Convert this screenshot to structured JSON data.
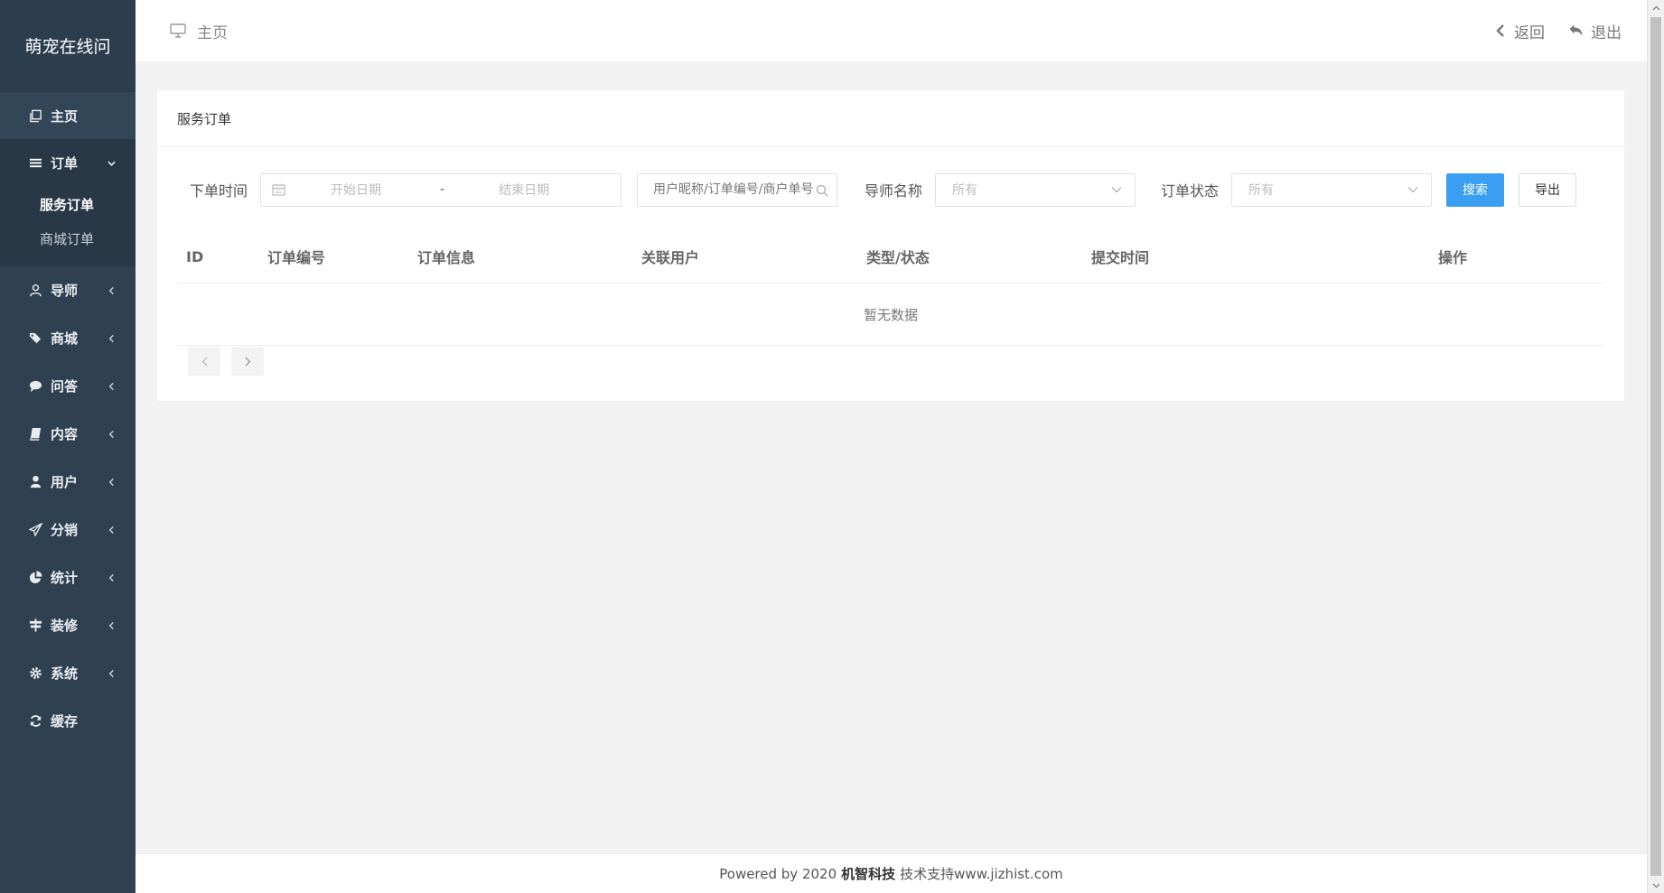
{
  "sidebar": {
    "brand": "萌宠在线问",
    "home": "主页",
    "order_group": {
      "label": "订单",
      "items": [
        "服务订单",
        "商城订单"
      ]
    },
    "items": [
      {
        "label": "导师",
        "icon": "user-icon"
      },
      {
        "label": "商城",
        "icon": "tags-icon"
      },
      {
        "label": "问答",
        "icon": "comment-icon"
      },
      {
        "label": "内容",
        "icon": "book-icon"
      },
      {
        "label": "用户",
        "icon": "person-icon"
      },
      {
        "label": "分销",
        "icon": "paper-plane-icon"
      },
      {
        "label": "统计",
        "icon": "pie-chart-icon"
      },
      {
        "label": "装修",
        "icon": "sign-icon"
      },
      {
        "label": "系统",
        "icon": "gear-icon"
      },
      {
        "label": "缓存",
        "icon": "refresh-icon"
      }
    ]
  },
  "topbar": {
    "breadcrumb": "主页",
    "back": "返回",
    "logout": "退出"
  },
  "card": {
    "title": "服务订单",
    "filters": {
      "order_time_label": "下单时间",
      "start_placeholder": "开始日期",
      "separator": "-",
      "end_placeholder": "结束日期",
      "keyword_placeholder": "用户昵称/订单编号/商户单号",
      "mentor_label": "导师名称",
      "mentor_value": "所有",
      "status_label": "订单状态",
      "status_value": "所有",
      "search_button": "搜索",
      "export_button": "导出"
    },
    "table": {
      "columns": [
        "ID",
        "订单编号",
        "订单信息",
        "关联用户",
        "类型/状态",
        "提交时间",
        "操作"
      ],
      "empty_text": "暂无数据"
    }
  },
  "footer": {
    "prefix": "Powered by 2020",
    "company": "机智科技",
    "suffix": "技术支持www.jizhist.com"
  }
}
